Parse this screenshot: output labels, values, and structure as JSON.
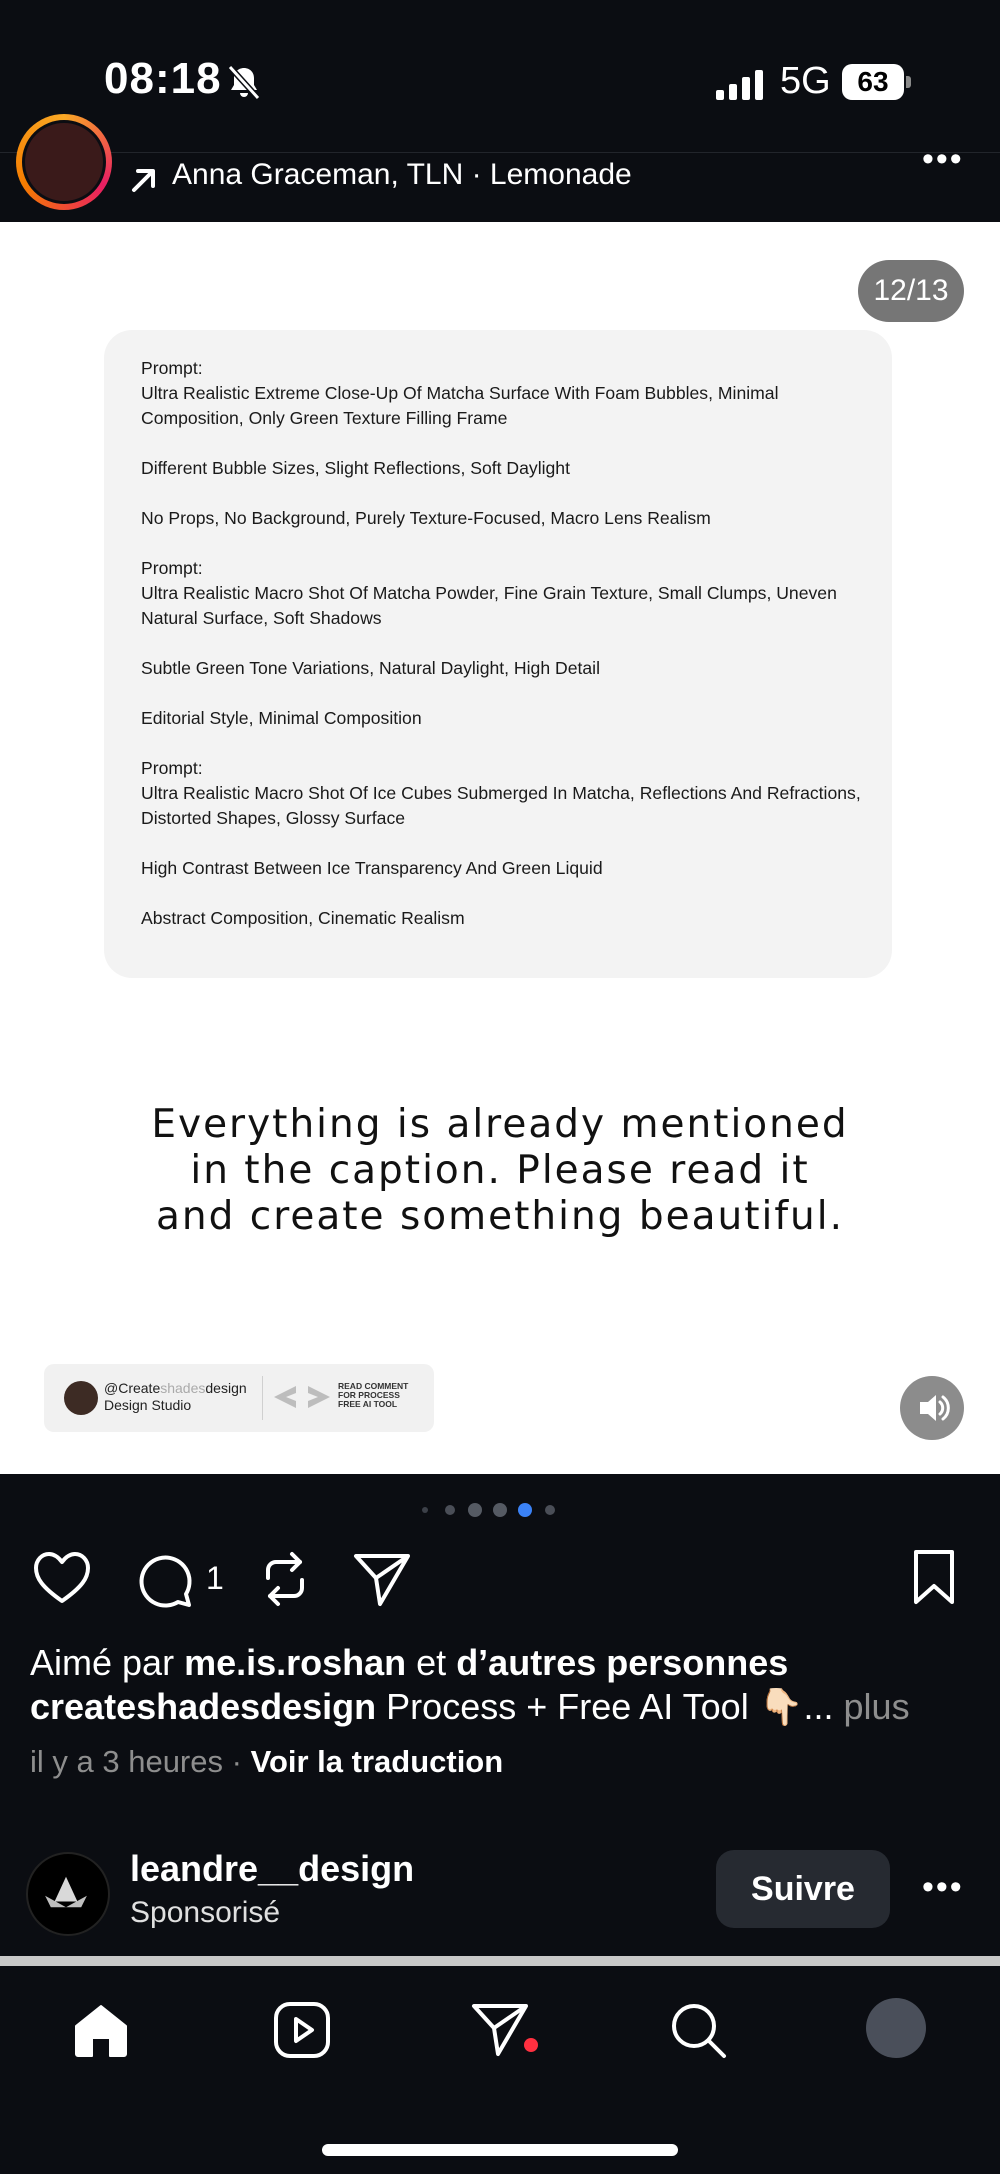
{
  "status_bar": {
    "time": "08:18",
    "network": "5G",
    "battery": "63",
    "icons": [
      "bell-slash-icon",
      "signal-icon",
      "battery-icon"
    ]
  },
  "post_header": {
    "subtitle": "Anna Graceman, TLN · Lemonade",
    "icons": [
      "avatar",
      "arrow-up-right-icon",
      "more-icon"
    ]
  },
  "slide": {
    "counter": "12/13",
    "prompts": [
      {
        "label": "Prompt:",
        "lines": [
          "Ultra Realistic Extreme Close-Up Of Matcha Surface With Foam Bubbles, Minimal Composition, Only Green Texture Filling Frame",
          "Different Bubble Sizes, Slight Reflections, Soft Daylight",
          "No Props, No Background, Purely Texture-Focused, Macro Lens Realism"
        ]
      },
      {
        "label": "Prompt:",
        "lines": [
          "Ultra Realistic Macro Shot Of Matcha Powder, Fine Grain Texture, Small Clumps, Uneven Natural Surface, Soft Shadows",
          "Subtle Green Tone Variations, Natural Daylight, High Detail",
          "Editorial Style, Minimal Composition"
        ]
      },
      {
        "label": "Prompt:",
        "lines": [
          "Ultra Realistic Macro Shot Of Ice Cubes Submerged In Matcha, Reflections And Refractions, Distorted Shapes, Glossy Surface",
          "High Contrast Between Ice Transparency And Green Liquid",
          "Abstract Composition, Cinematic Realism"
        ]
      }
    ],
    "cta_lines": [
      "Everything is already mentioned",
      "in the caption. Please read it",
      "and create something beautiful."
    ],
    "badge": {
      "handle_start": "@Create",
      "handle_dim": "shades",
      "handle_end": "design",
      "studio": "Design Studio",
      "read_lines": [
        "READ COMMENT",
        "FOR PROCESS",
        "FREE AI TOOL"
      ]
    }
  },
  "actions": {
    "comment_count": "1",
    "icons": [
      "heart-icon",
      "comment-icon",
      "repost-icon",
      "share-icon",
      "bookmark-icon"
    ]
  },
  "likes": {
    "prefix": "Aimé par ",
    "user": "me.is.roshan",
    "middle": " et ",
    "others": "d’autres personnes"
  },
  "caption": {
    "user": "createshadesdesign",
    "text": " Process + Free AI Tool 👇🏻",
    "more_prefix": "... ",
    "more": "plus"
  },
  "meta": {
    "time": "il y a 3 heures",
    "separator": " · ",
    "translate": "Voir la traduction"
  },
  "sponsored": {
    "name": "leandre__design",
    "label": "Sponsorisé",
    "follow": "Suivre"
  },
  "tab_bar": {
    "icons": [
      "home-icon",
      "reels-icon",
      "messages-icon",
      "search-icon",
      "profile-avatar"
    ]
  },
  "colors": {
    "background": "#0b0d12",
    "active_dot": "#3b82f6",
    "notification_dot": "#ff3040"
  }
}
